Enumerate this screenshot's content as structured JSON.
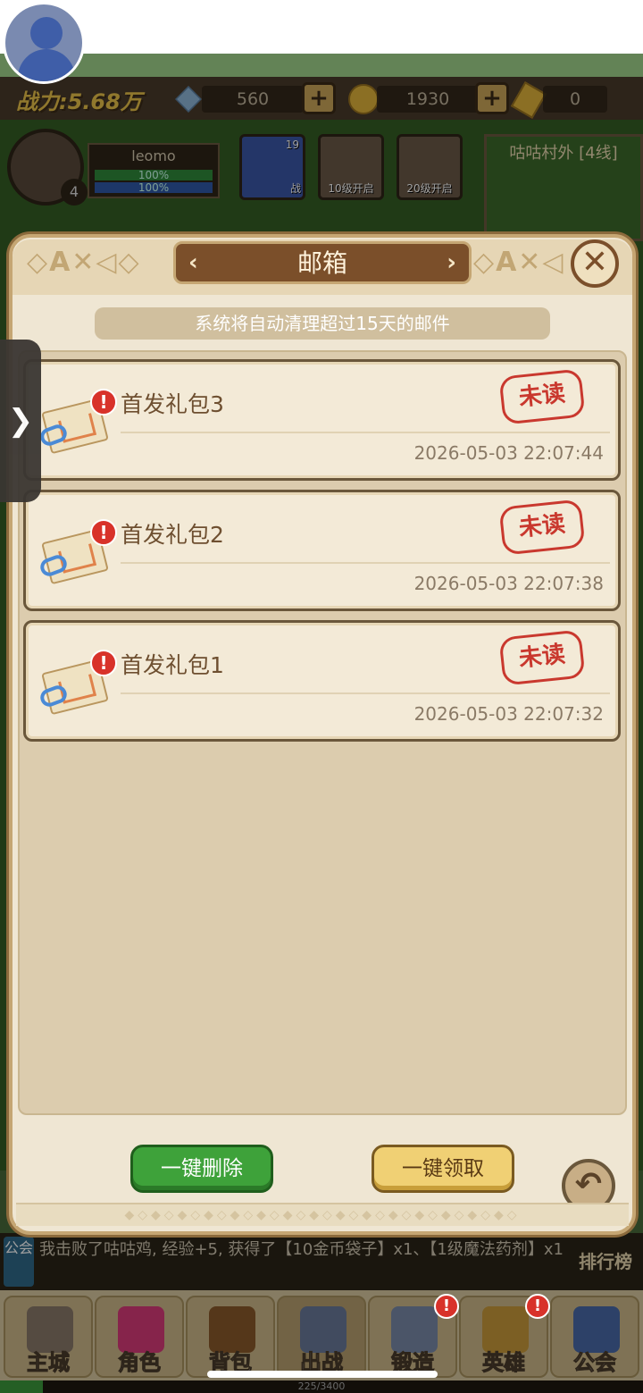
{
  "hud": {
    "power_label": "战力:5.68万",
    "gems": "560",
    "gold": "1930",
    "tickets": "0",
    "plus": "+",
    "player_name": "leomo",
    "hp_pct": "100%",
    "mp_pct": "100%",
    "player_level": "4",
    "slots": [
      {
        "level": "19",
        "tag": "战"
      },
      {
        "text": "10级开启"
      },
      {
        "text": "20级开启"
      }
    ],
    "map_name": "咕咕村外 [4线]"
  },
  "mailbox": {
    "title": "邮箱",
    "notice": "系统将自动清理超过15天的邮件",
    "close_label": "✕",
    "mails": [
      {
        "subject": "首发礼包3",
        "status": "未读",
        "time": "2026-05-03 22:07:44"
      },
      {
        "subject": "首发礼包2",
        "status": "未读",
        "time": "2026-05-03 22:07:38"
      },
      {
        "subject": "首发礼包1",
        "status": "未读",
        "time": "2026-05-03 22:07:32"
      }
    ],
    "delete_all_label": "一键删除",
    "claim_all_label": "一键领取",
    "back_label": "↶",
    "side_tab_label": "❯"
  },
  "chat": {
    "channel": "公会",
    "message": "我击败了咕咕鸡, 经验+5, 获得了【10金币袋子】x1、【1级魔法药剂】x1",
    "rank_label": "排行榜"
  },
  "nav": {
    "items": [
      "主城",
      "角色",
      "背包",
      "出战",
      "锻造",
      "英雄",
      "公会"
    ]
  },
  "xp": {
    "text": "225/3400",
    "fraction": 0.066
  }
}
